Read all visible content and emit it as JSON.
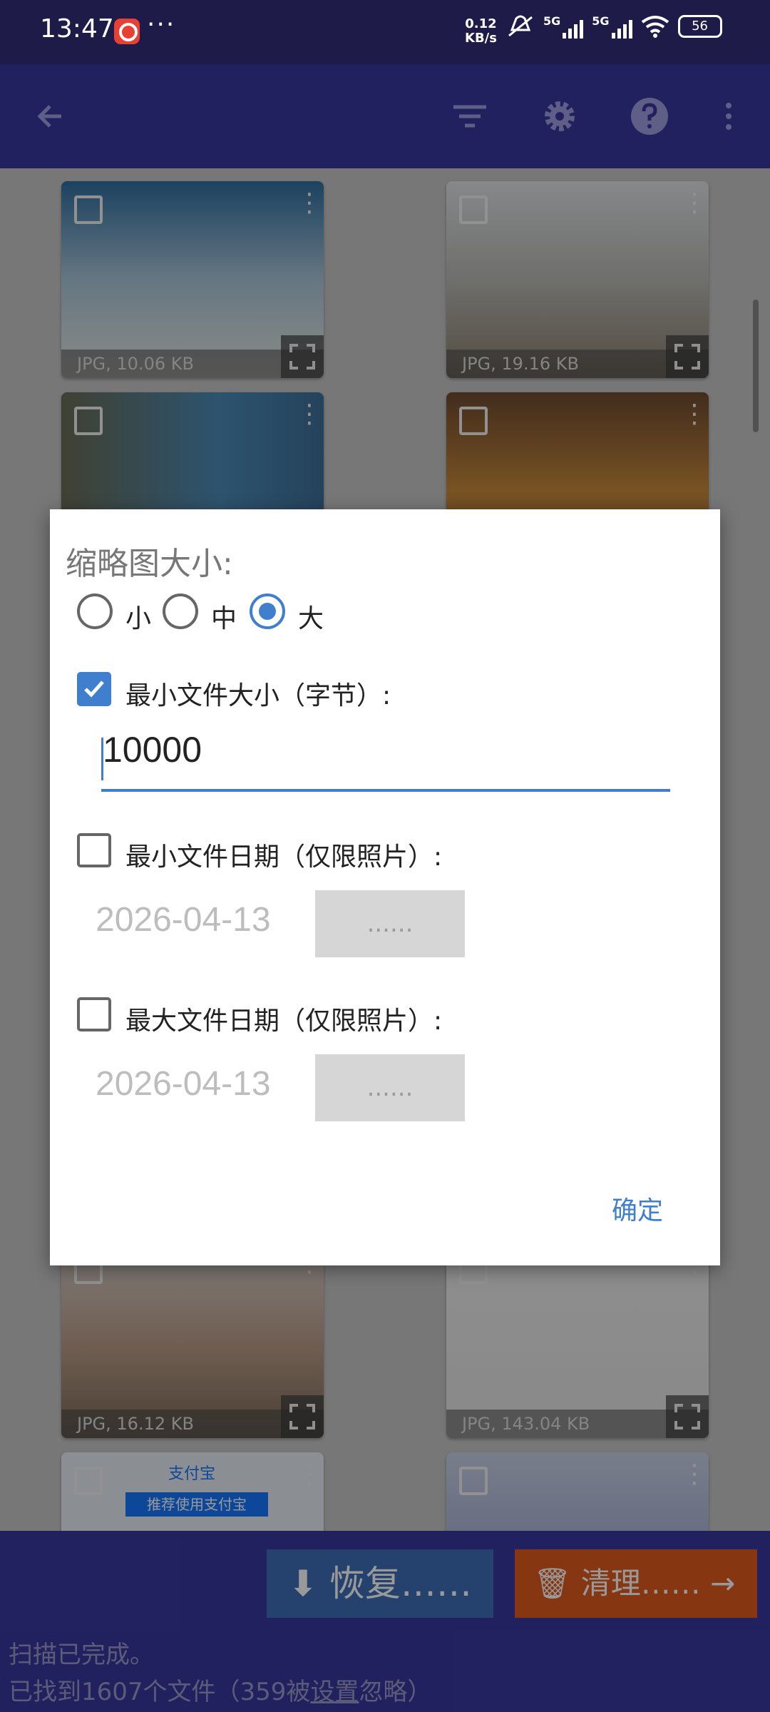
{
  "status_bar": {
    "time": "13:47",
    "dots": "···",
    "speed_value": "0.12",
    "speed_unit": "KB/s",
    "net1": "5G",
    "net2": "5G",
    "battery": "56"
  },
  "thumbnails": [
    {
      "caption": "JPG, 10.06 KB"
    },
    {
      "caption": "JPG, 19.16 KB"
    },
    {
      "caption": "JPG, 16.12 KB"
    },
    {
      "caption": "JPG, 143.04 KB"
    },
    {
      "caption": "",
      "label": "支付宝",
      "banner": "推荐使用支付宝"
    }
  ],
  "bottom": {
    "restore_label": "恢复……",
    "clean_label": "清理……",
    "status1": "扫描已完成。",
    "status2_prefix": "已找到1607个文件（359被",
    "status2_link": "设置",
    "status2_suffix": "忽略）"
  },
  "dialog": {
    "title": "缩略图大小:",
    "sizes": {
      "small": "小",
      "medium": "中",
      "large": "大",
      "selected": "large"
    },
    "min_size_label": "最小文件大小（字节）:",
    "min_size_checked": true,
    "min_size_value": "10000",
    "min_date_label": "最小文件日期（仅限照片）:",
    "min_date_checked": false,
    "min_date_value": "2026-04-13",
    "max_date_label": "最大文件日期（仅限照片）:",
    "max_date_checked": false,
    "max_date_value": "2026-04-13",
    "pick_label": "......",
    "ok_label": "确定"
  },
  "colors": {
    "primary": "#3a38a0",
    "accent": "#3f7fce",
    "restore": "#3d6fb6",
    "clean": "#e05b1c"
  }
}
